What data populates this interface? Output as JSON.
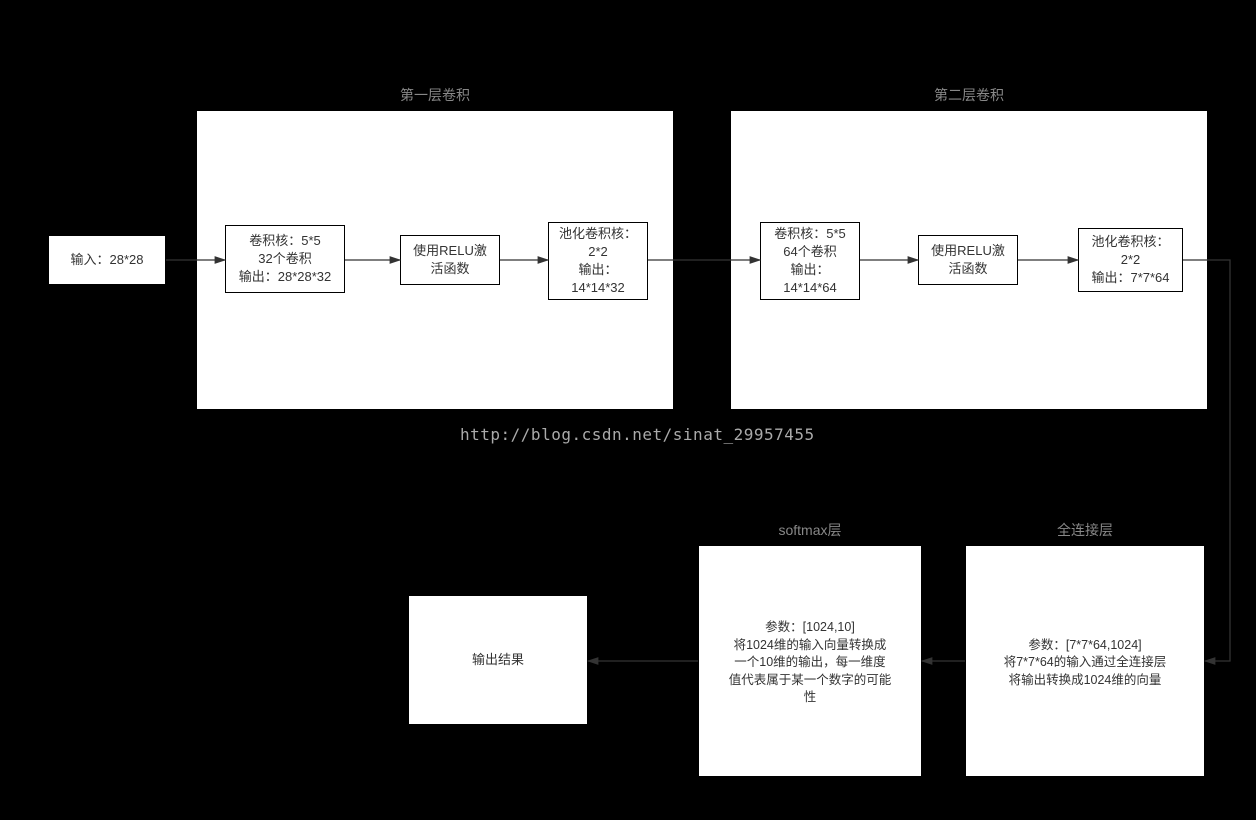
{
  "labels": {
    "layer1": "第一层卷积",
    "layer2": "第二层卷积",
    "softmax": "softmax层",
    "fc": "全连接层"
  },
  "boxes": {
    "input": "输入：28*28",
    "conv1_kernel": "卷积核：5*5\n32个卷积\n输出：28*28*32",
    "conv1_relu": "使用RELU激\n活函数",
    "conv1_pool": "池化卷积核：\n2*2\n输出：\n14*14*32",
    "conv2_kernel": "卷积核：5*5\n64个卷积\n输出：\n14*14*64",
    "conv2_relu": "使用RELU激\n活函数",
    "conv2_pool": "池化卷积核：\n2*2\n输出：7*7*64",
    "fc_box": "参数：[7*7*64,1024]\n将7*7*64的输入通过全连接层\n将输出转换成1024维的向量",
    "softmax_box": "参数：[1024,10]\n将1024维的输入向量转换成\n一个10维的输出，每一维度\n值代表属于某一个数字的可能\n性",
    "output": "输出结果"
  },
  "watermark": "http://blog.csdn.net/sinat_29957455",
  "chart_data": {
    "type": "flow-diagram",
    "title": "CNN Architecture (MNIST)",
    "nodes": [
      {
        "id": "input",
        "label": "输入：28*28"
      },
      {
        "id": "conv1_kernel",
        "label": "卷积核：5*5 / 32个卷积 / 输出：28*28*32",
        "group": "第一层卷积"
      },
      {
        "id": "conv1_relu",
        "label": "使用RELU激活函数",
        "group": "第一层卷积"
      },
      {
        "id": "conv1_pool",
        "label": "池化卷积核：2*2 / 输出：14*14*32",
        "group": "第一层卷积"
      },
      {
        "id": "conv2_kernel",
        "label": "卷积核：5*5 / 64个卷积 / 输出：14*14*64",
        "group": "第二层卷积"
      },
      {
        "id": "conv2_relu",
        "label": "使用RELU激活函数",
        "group": "第二层卷积"
      },
      {
        "id": "conv2_pool",
        "label": "池化卷积核：2*2 / 输出：7*7*64",
        "group": "第二层卷积"
      },
      {
        "id": "fc",
        "label": "参数：[7*7*64,1024] 全连接层 输出1024维向量",
        "group": "全连接层"
      },
      {
        "id": "softmax",
        "label": "参数：[1024,10] softmax 输出10维",
        "group": "softmax层"
      },
      {
        "id": "output",
        "label": "输出结果"
      }
    ],
    "edges": [
      [
        "input",
        "conv1_kernel"
      ],
      [
        "conv1_kernel",
        "conv1_relu"
      ],
      [
        "conv1_relu",
        "conv1_pool"
      ],
      [
        "conv1_pool",
        "conv2_kernel"
      ],
      [
        "conv2_kernel",
        "conv2_relu"
      ],
      [
        "conv2_relu",
        "conv2_pool"
      ],
      [
        "conv2_pool",
        "fc"
      ],
      [
        "fc",
        "softmax"
      ],
      [
        "softmax",
        "output"
      ]
    ]
  }
}
